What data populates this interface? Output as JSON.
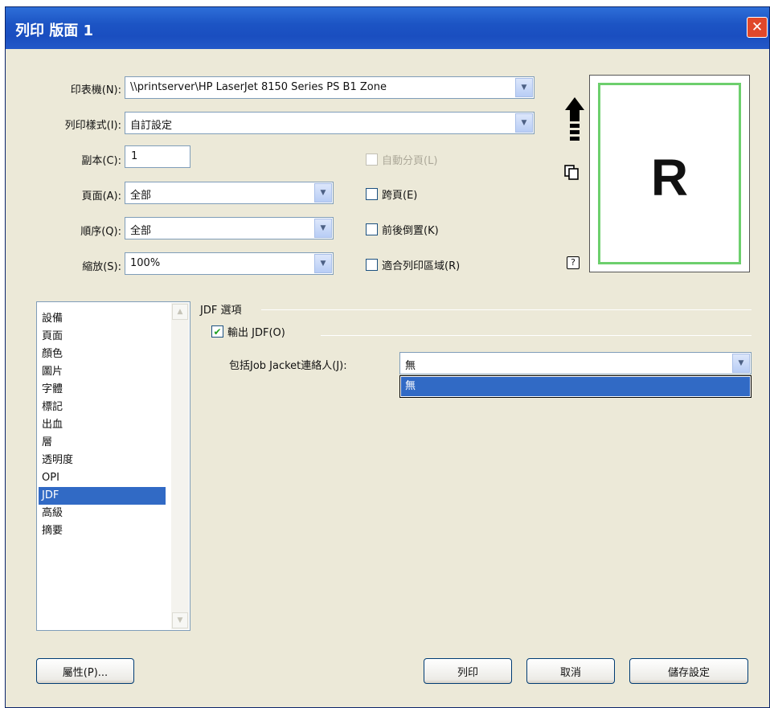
{
  "window": {
    "title": "列印 版面 1",
    "close_icon": "close-icon"
  },
  "form": {
    "printer": {
      "label": "印表機(N):",
      "value": "\\\\printserver\\HP LaserJet 8150 Series PS  B1 Zone"
    },
    "print_style": {
      "label": "列印樣式(I):",
      "value": "自訂設定"
    },
    "copies": {
      "label": "副本(C):",
      "value": "1"
    },
    "pages": {
      "label": "頁面(A):",
      "value": "全部"
    },
    "order": {
      "label": "順序(Q):",
      "value": "全部"
    },
    "scale": {
      "label": "縮放(S):",
      "value": "100%"
    },
    "collate": {
      "label": "自動分頁(L)",
      "checked": false,
      "disabled": true
    },
    "spreads": {
      "label": "跨頁(E)",
      "checked": false
    },
    "back_to_front": {
      "label": "前後倒置(K)",
      "checked": false
    },
    "fit_in_print_area": {
      "label": "適合列印區域(R)",
      "checked": false
    }
  },
  "preview": {
    "letter": "R",
    "help_label": "?"
  },
  "categories": {
    "items": [
      "設備",
      "頁面",
      "顏色",
      "圖片",
      "字體",
      "標記",
      "出血",
      "層",
      "透明度",
      "OPI",
      "JDF",
      "高級",
      "摘要"
    ],
    "selected": "JDF"
  },
  "jdf": {
    "group_title": "JDF 選項",
    "output_jdf": {
      "label": "輸出 JDF(O)",
      "checked": true
    },
    "contacts": {
      "label": "包括Job Jacket連絡人(J):",
      "value": "無",
      "options": [
        "無"
      ]
    }
  },
  "buttons": {
    "properties": "屬性(P)...",
    "print": "列印",
    "cancel": "取消",
    "save_settings": "儲存設定"
  },
  "colors": {
    "title_bar": "#1c54c4",
    "selection": "#316ac5",
    "preview_border": "#6dcf6d",
    "dialog_bg": "#ece9d8"
  }
}
